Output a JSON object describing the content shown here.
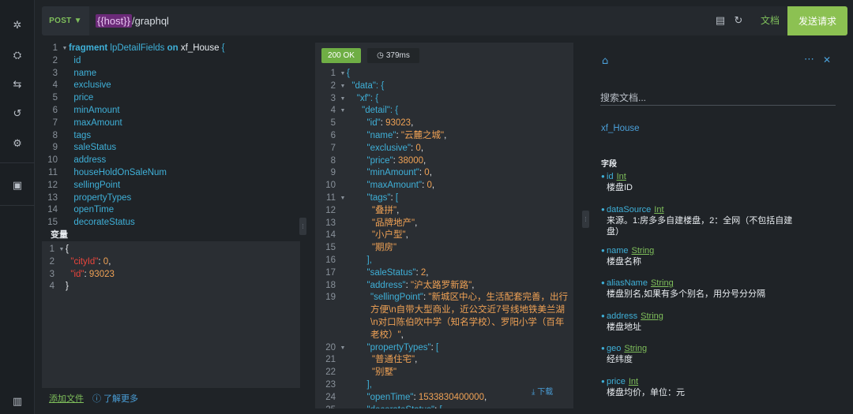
{
  "rail": {
    "icons": [
      "settings-icon",
      "share-icon",
      "history-swap-icon",
      "history-icon",
      "extension-icon",
      "briefcase-icon",
      "book-icon"
    ]
  },
  "toolbar": {
    "method": "POST ▼",
    "url_var": "{{host}}",
    "url_path": "/graphql",
    "docs_label": "文档",
    "send_label": "发送请求"
  },
  "query": {
    "lines": [
      {
        "n": "1",
        "fold": true,
        "parts": [
          [
            "kw",
            "fragment "
          ],
          [
            "code",
            "lpDetailFields "
          ],
          [
            "kw",
            "on "
          ],
          [
            "plain",
            "xf_House "
          ],
          [
            "brace",
            "{"
          ]
        ]
      },
      {
        "n": "2",
        "parts": [
          [
            "code",
            "  id"
          ]
        ]
      },
      {
        "n": "3",
        "parts": [
          [
            "code",
            "  name"
          ]
        ]
      },
      {
        "n": "4",
        "parts": [
          [
            "code",
            "  exclusive"
          ]
        ]
      },
      {
        "n": "5",
        "parts": [
          [
            "code",
            "  price"
          ]
        ]
      },
      {
        "n": "6",
        "parts": [
          [
            "code",
            "  minAmount"
          ]
        ]
      },
      {
        "n": "7",
        "parts": [
          [
            "code",
            "  maxAmount"
          ]
        ]
      },
      {
        "n": "8",
        "parts": [
          [
            "code",
            "  tags"
          ]
        ]
      },
      {
        "n": "9",
        "parts": [
          [
            "code",
            "  saleStatus"
          ]
        ]
      },
      {
        "n": "10",
        "parts": [
          [
            "code",
            "  address"
          ]
        ]
      },
      {
        "n": "11",
        "parts": [
          [
            "code",
            "  houseHoldOnSaleNum"
          ]
        ]
      },
      {
        "n": "12",
        "parts": [
          [
            "code",
            "  sellingPoint"
          ]
        ]
      },
      {
        "n": "13",
        "parts": [
          [
            "code",
            "  propertyTypes"
          ]
        ]
      },
      {
        "n": "14",
        "parts": [
          [
            "code",
            "  openTime"
          ]
        ]
      },
      {
        "n": "15",
        "parts": [
          [
            "code",
            "  decorateStatus"
          ]
        ]
      }
    ]
  },
  "variables": {
    "title": "变量",
    "lines": [
      {
        "n": "1",
        "fold": true,
        "parts": [
          [
            "plain",
            "{"
          ]
        ]
      },
      {
        "n": "2",
        "parts": [
          [
            "key",
            "  \"cityId\""
          ],
          [
            "plain",
            ": "
          ],
          [
            "num",
            "0"
          ],
          [
            "plain",
            ","
          ]
        ]
      },
      {
        "n": "3",
        "parts": [
          [
            "key",
            "  \"id\""
          ],
          [
            "plain",
            ": "
          ],
          [
            "num",
            "93023"
          ]
        ]
      },
      {
        "n": "4",
        "parts": [
          [
            "plain",
            "}"
          ]
        ]
      }
    ],
    "add_file": "添加文件",
    "learn_more": "ⓘ 了解更多"
  },
  "response": {
    "status": "200 OK",
    "time": "379ms",
    "download": "⤓ 下载",
    "lines": [
      {
        "n": "1",
        "fold": true,
        "parts": [
          [
            "rtext",
            "{"
          ]
        ]
      },
      {
        "n": "2",
        "fold": true,
        "parts": [
          [
            "rtext",
            "  \"data\": {"
          ]
        ]
      },
      {
        "n": "3",
        "fold": true,
        "parts": [
          [
            "rtext",
            "    \"xf\": {"
          ]
        ]
      },
      {
        "n": "4",
        "fold": true,
        "parts": [
          [
            "rtext",
            "      \"detail\": {"
          ]
        ]
      },
      {
        "n": "5",
        "parts": [
          [
            "rtext",
            "        \"id\""
          ],
          [
            "plain",
            ": "
          ],
          [
            "num",
            "93023"
          ],
          [
            "plain",
            ","
          ]
        ]
      },
      {
        "n": "6",
        "parts": [
          [
            "rtext",
            "        \"name\""
          ],
          [
            "plain",
            ": "
          ],
          [
            "str",
            "\"云麓之城\""
          ],
          [
            "plain",
            ","
          ]
        ]
      },
      {
        "n": "7",
        "parts": [
          [
            "rtext",
            "        \"exclusive\""
          ],
          [
            "plain",
            ": "
          ],
          [
            "num",
            "0"
          ],
          [
            "plain",
            ","
          ]
        ]
      },
      {
        "n": "8",
        "parts": [
          [
            "rtext",
            "        \"price\""
          ],
          [
            "plain",
            ": "
          ],
          [
            "num",
            "38000"
          ],
          [
            "plain",
            ","
          ]
        ]
      },
      {
        "n": "9",
        "parts": [
          [
            "rtext",
            "        \"minAmount\""
          ],
          [
            "plain",
            ": "
          ],
          [
            "num",
            "0"
          ],
          [
            "plain",
            ","
          ]
        ]
      },
      {
        "n": "10",
        "parts": [
          [
            "rtext",
            "        \"maxAmount\""
          ],
          [
            "plain",
            ": "
          ],
          [
            "num",
            "0"
          ],
          [
            "plain",
            ","
          ]
        ]
      },
      {
        "n": "11",
        "fold": true,
        "parts": [
          [
            "rtext",
            "        \"tags\""
          ],
          [
            "plain",
            ": "
          ],
          [
            "rtext",
            "["
          ]
        ]
      },
      {
        "n": "12",
        "parts": [
          [
            "str",
            "          \"叠拼\""
          ],
          [
            "plain",
            ","
          ]
        ]
      },
      {
        "n": "13",
        "parts": [
          [
            "str",
            "          \"品牌地产\""
          ],
          [
            "plain",
            ","
          ]
        ]
      },
      {
        "n": "14",
        "parts": [
          [
            "str",
            "          \"小户型\""
          ],
          [
            "plain",
            ","
          ]
        ]
      },
      {
        "n": "15",
        "parts": [
          [
            "str",
            "          \"期房\""
          ]
        ]
      },
      {
        "n": "16",
        "parts": [
          [
            "rtext",
            "        ],"
          ]
        ]
      },
      {
        "n": "17",
        "parts": [
          [
            "rtext",
            "        \"saleStatus\""
          ],
          [
            "plain",
            ": "
          ],
          [
            "num",
            "2"
          ],
          [
            "plain",
            ","
          ]
        ]
      },
      {
        "n": "18",
        "parts": [
          [
            "rtext",
            "        \"address\""
          ],
          [
            "plain",
            ": "
          ],
          [
            "str",
            "\"沪太路罗新路\""
          ],
          [
            "plain",
            ","
          ]
        ]
      },
      {
        "n": "19",
        "wrap": true,
        "parts": [
          [
            "rtext",
            "\"sellingPoint\""
          ],
          [
            "plain",
            ": "
          ],
          [
            "str",
            "\"新城区中心，生活配套完善，出行方便\\n自带大型商业，近公交近7号线地铁美兰湖\\n对口陈伯吹中学（知名学校）、罗阳小学（百年老校）\""
          ],
          [
            "plain",
            ","
          ]
        ]
      },
      {
        "n": "20",
        "fold": true,
        "parts": [
          [
            "rtext",
            "        \"propertyTypes\""
          ],
          [
            "plain",
            ": "
          ],
          [
            "rtext",
            "["
          ]
        ]
      },
      {
        "n": "21",
        "parts": [
          [
            "str",
            "          \"普通住宅\""
          ],
          [
            "plain",
            ","
          ]
        ]
      },
      {
        "n": "22",
        "parts": [
          [
            "str",
            "          \"别墅\""
          ]
        ]
      },
      {
        "n": "23",
        "parts": [
          [
            "rtext",
            "        ],"
          ]
        ]
      },
      {
        "n": "24",
        "parts": [
          [
            "rtext",
            "        \"openTime\""
          ],
          [
            "plain",
            ": "
          ],
          [
            "num",
            "1533830400000"
          ],
          [
            "plain",
            ","
          ]
        ]
      },
      {
        "n": "25",
        "fold": true,
        "parts": [
          [
            "rtext",
            "        \"decorateStatus\""
          ],
          [
            "plain",
            ": "
          ],
          [
            "rtext",
            "["
          ]
        ]
      }
    ]
  },
  "docs": {
    "search_placeholder": "搜索文档...",
    "type_name": "xf_House",
    "fields_title": "字段",
    "fields": [
      {
        "name": "id",
        "type": "Int",
        "desc": "楼盘ID"
      },
      {
        "name": "dataSource",
        "type": "Int",
        "desc": "来源。1:房多多自建楼盘，2：全网（不包括自建盘）"
      },
      {
        "name": "name",
        "type": "String",
        "desc": "楼盘名称"
      },
      {
        "name": "aliasName",
        "type": "String",
        "desc": "楼盘别名,如果有多个别名，用分号分分隔"
      },
      {
        "name": "address",
        "type": "String",
        "desc": "楼盘地址"
      },
      {
        "name": "geo",
        "type": "String",
        "desc": "经纬度"
      },
      {
        "name": "price",
        "type": "Int",
        "desc": "楼盘均价，单位：元"
      }
    ]
  }
}
